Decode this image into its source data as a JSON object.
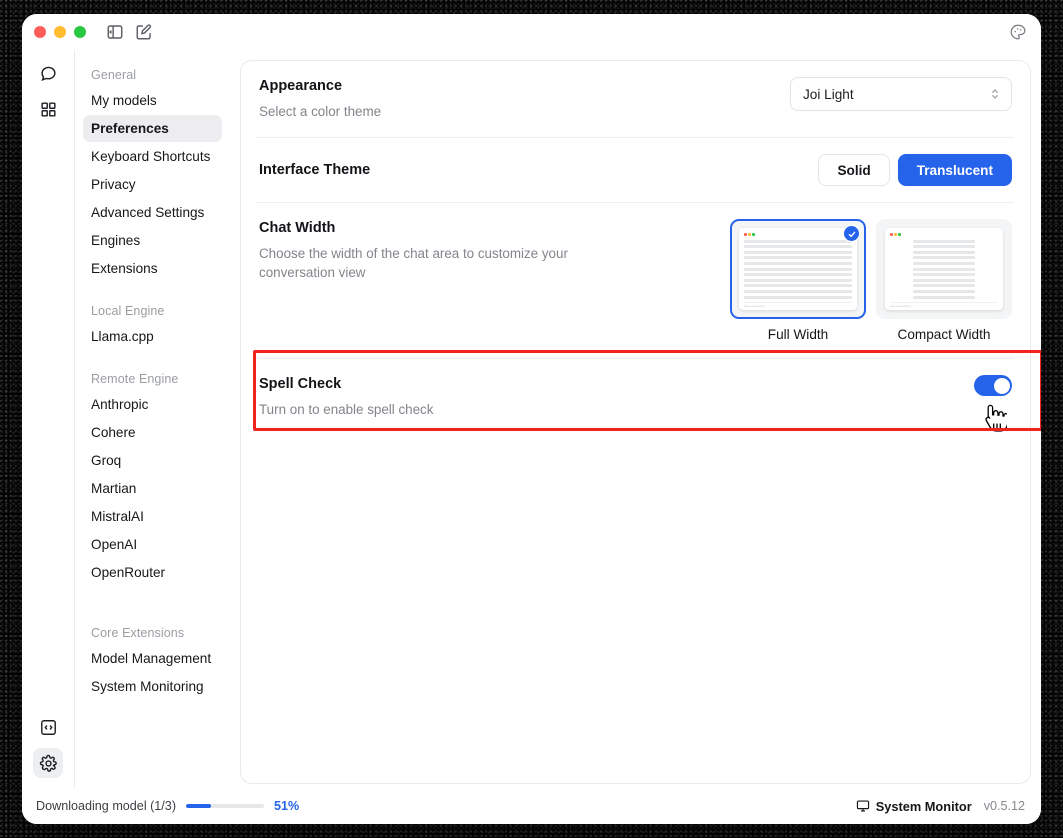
{
  "titlebar": {
    "traffic": [
      {
        "name": "close",
        "color": "#ff5f57"
      },
      {
        "name": "minimize",
        "color": "#febc2e"
      },
      {
        "name": "maximize",
        "color": "#28c840"
      }
    ],
    "sidebar_toggle_icon": "panel-left-icon",
    "compose_icon": "compose-icon",
    "palette_icon": "palette-icon"
  },
  "rail": {
    "items": [
      {
        "name": "chat",
        "icon": "chat-bubble-icon",
        "active": false
      },
      {
        "name": "apps",
        "icon": "grid-squares-icon",
        "active": false
      }
    ],
    "bottom": [
      {
        "name": "code",
        "icon": "code-brackets-icon",
        "active": false
      },
      {
        "name": "settings",
        "icon": "gear-icon",
        "active": true
      }
    ]
  },
  "sidebar": {
    "groups": [
      {
        "label": "General",
        "items": [
          {
            "label": "My models",
            "selected": false
          },
          {
            "label": "Preferences",
            "selected": true
          },
          {
            "label": "Keyboard Shortcuts",
            "selected": false
          },
          {
            "label": "Privacy",
            "selected": false
          },
          {
            "label": "Advanced Settings",
            "selected": false
          },
          {
            "label": "Engines",
            "selected": false
          },
          {
            "label": "Extensions",
            "selected": false
          }
        ]
      },
      {
        "label": "Local Engine",
        "items": [
          {
            "label": "Llama.cpp",
            "selected": false
          }
        ]
      },
      {
        "label": "Remote Engine",
        "items": [
          {
            "label": "Anthropic",
            "selected": false
          },
          {
            "label": "Cohere",
            "selected": false
          },
          {
            "label": "Groq",
            "selected": false
          },
          {
            "label": "Martian",
            "selected": false
          },
          {
            "label": "MistralAI",
            "selected": false
          },
          {
            "label": "OpenAI",
            "selected": false
          },
          {
            "label": "OpenRouter",
            "selected": false
          }
        ]
      },
      {
        "label": "Core Extensions",
        "items": [
          {
            "label": "Model Management",
            "selected": false
          },
          {
            "label": "System Monitoring",
            "selected": false
          }
        ]
      }
    ]
  },
  "settings": {
    "appearance": {
      "title": "Appearance",
      "desc": "Select a color theme",
      "theme_value": "Joi Light",
      "theme_options": [
        "Joi Light"
      ]
    },
    "interface_theme": {
      "title": "Interface Theme",
      "options": [
        {
          "label": "Solid",
          "active": false
        },
        {
          "label": "Translucent",
          "active": true
        }
      ]
    },
    "chat_width": {
      "title": "Chat Width",
      "desc": "Choose the width of the chat area to customize your conversation view",
      "cards": [
        {
          "label": "Full Width",
          "selected": true,
          "preview_footer": "Ask me anything",
          "layout": "full"
        },
        {
          "label": "Compact Width",
          "selected": false,
          "preview_footer": "Ask me anything",
          "layout": "compact"
        }
      ]
    },
    "spell_check": {
      "title": "Spell Check",
      "desc": "Turn on to enable spell check",
      "enabled": true
    }
  },
  "statusbar": {
    "download_text": "Downloading model (1/3)",
    "progress_percent": "51%",
    "progress_fill_ratio": 32,
    "system_monitor_label": "System Monitor",
    "system_monitor_icon": "monitor-icon",
    "version": "v0.5.12"
  },
  "colors": {
    "accent": "#2563eb",
    "annotation": "#f2231f",
    "selected_bg": "#ededef"
  }
}
